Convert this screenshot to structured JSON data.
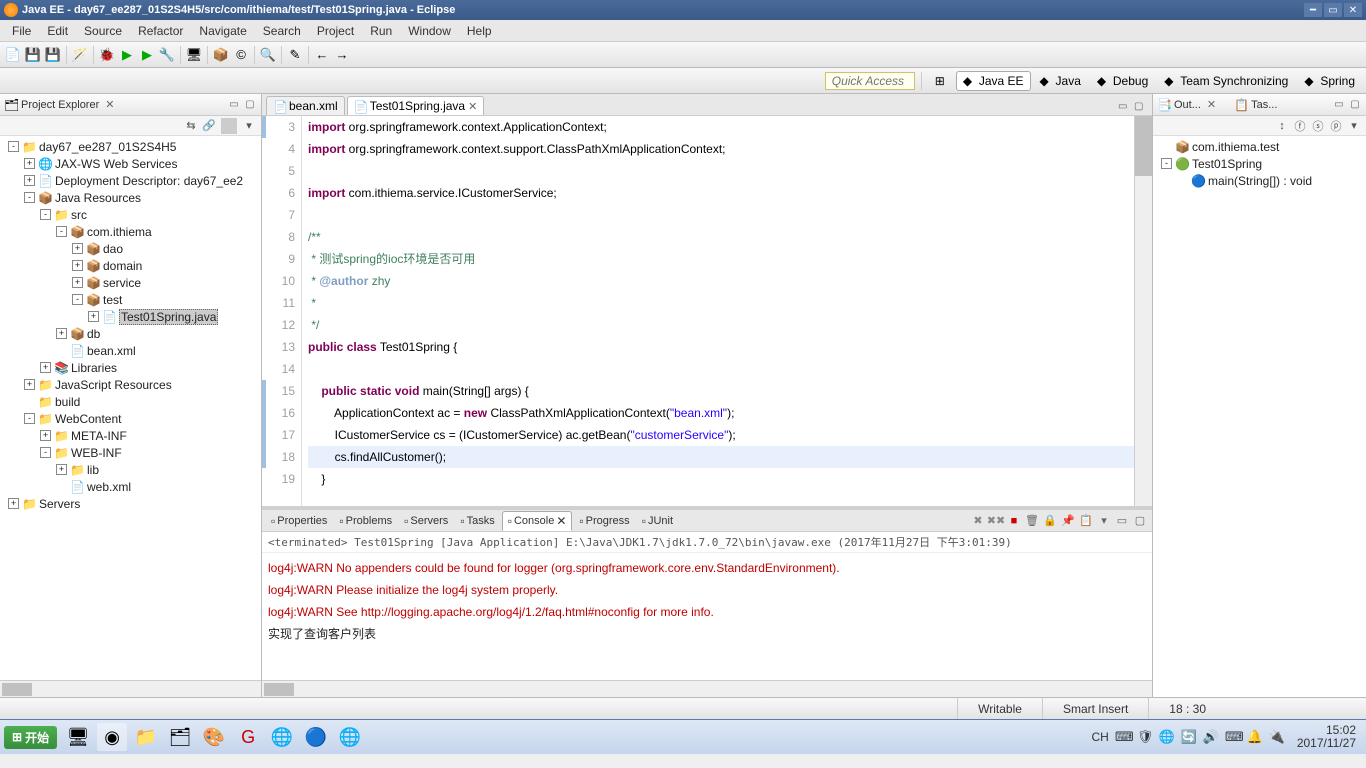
{
  "title": "Java EE - day67_ee287_01S2S4H5/src/com/ithiema/test/Test01Spring.java - Eclipse",
  "menu": [
    "File",
    "Edit",
    "Source",
    "Refactor",
    "Navigate",
    "Search",
    "Project",
    "Run",
    "Window",
    "Help"
  ],
  "quick_access": "Quick Access",
  "perspectives": [
    {
      "label": "Java EE",
      "active": true
    },
    {
      "label": "Java",
      "active": false
    },
    {
      "label": "Debug",
      "active": false
    },
    {
      "label": "Team Synchronizing",
      "active": false
    },
    {
      "label": "Spring",
      "active": false
    }
  ],
  "project_explorer": {
    "title": "Project Explorer",
    "tree": [
      {
        "depth": 0,
        "exp": "-",
        "ico": "📁",
        "label": "day67_ee287_01S2S4H5"
      },
      {
        "depth": 1,
        "exp": "+",
        "ico": "🌐",
        "label": "JAX-WS Web Services"
      },
      {
        "depth": 1,
        "exp": "+",
        "ico": "📄",
        "label": "Deployment Descriptor: day67_ee2"
      },
      {
        "depth": 1,
        "exp": "-",
        "ico": "📦",
        "label": "Java Resources"
      },
      {
        "depth": 2,
        "exp": "-",
        "ico": "📁",
        "label": "src"
      },
      {
        "depth": 3,
        "exp": "-",
        "ico": "📦",
        "label": "com.ithiema"
      },
      {
        "depth": 4,
        "exp": "+",
        "ico": "📦",
        "label": "dao"
      },
      {
        "depth": 4,
        "exp": "+",
        "ico": "📦",
        "label": "domain"
      },
      {
        "depth": 4,
        "exp": "+",
        "ico": "📦",
        "label": "service"
      },
      {
        "depth": 4,
        "exp": "-",
        "ico": "📦",
        "label": "test"
      },
      {
        "depth": 5,
        "exp": "+",
        "ico": "📄",
        "label": "Test01Spring.java",
        "selected": true
      },
      {
        "depth": 3,
        "exp": "+",
        "ico": "📦",
        "label": "db"
      },
      {
        "depth": 3,
        "exp": "",
        "ico": "📄",
        "label": "bean.xml"
      },
      {
        "depth": 2,
        "exp": "+",
        "ico": "📚",
        "label": "Libraries"
      },
      {
        "depth": 1,
        "exp": "+",
        "ico": "📁",
        "label": "JavaScript Resources"
      },
      {
        "depth": 1,
        "exp": "",
        "ico": "📁",
        "label": "build"
      },
      {
        "depth": 1,
        "exp": "-",
        "ico": "📁",
        "label": "WebContent"
      },
      {
        "depth": 2,
        "exp": "+",
        "ico": "📁",
        "label": "META-INF"
      },
      {
        "depth": 2,
        "exp": "-",
        "ico": "📁",
        "label": "WEB-INF"
      },
      {
        "depth": 3,
        "exp": "+",
        "ico": "📁",
        "label": "lib"
      },
      {
        "depth": 3,
        "exp": "",
        "ico": "📄",
        "label": "web.xml"
      },
      {
        "depth": 0,
        "exp": "+",
        "ico": "📁",
        "label": "Servers"
      }
    ]
  },
  "editor": {
    "tabs": [
      {
        "label": "bean.xml",
        "ico": "📄",
        "active": false
      },
      {
        "label": "Test01Spring.java",
        "ico": "📄",
        "active": true
      }
    ],
    "lines": [
      {
        "n": 3,
        "html": "<span class='kw'>import</span> org.springframework.context.ApplicationContext;"
      },
      {
        "n": 4,
        "html": "<span class='kw'>import</span> org.springframework.context.support.ClassPathXmlApplicationContext;"
      },
      {
        "n": 5,
        "html": ""
      },
      {
        "n": 6,
        "html": "<span class='kw'>import</span> com.ithiema.service.ICustomerService;"
      },
      {
        "n": 7,
        "html": ""
      },
      {
        "n": 8,
        "html": "<span class='cmt'>/**</span>"
      },
      {
        "n": 9,
        "html": "<span class='cmt'> * 测试spring的ioc环境是否可用</span>"
      },
      {
        "n": 10,
        "html": "<span class='cmt'> * </span><span class='cmtt'>@author</span><span class='cmt'> zhy</span>"
      },
      {
        "n": 11,
        "html": "<span class='cmt'> *</span>"
      },
      {
        "n": 12,
        "html": "<span class='cmt'> */</span>"
      },
      {
        "n": 13,
        "html": "<span class='kw'>public</span> <span class='kw'>class</span> Test01Spring {"
      },
      {
        "n": 14,
        "html": ""
      },
      {
        "n": 15,
        "html": "    <span class='kw'>public</span> <span class='kw'>static</span> <span class='kw'>void</span> main(String[] args) {"
      },
      {
        "n": 16,
        "html": "        ApplicationContext ac = <span class='kw'>new</span> ClassPathXmlApplicationContext(<span class='str'>\"bean.xml\"</span>);"
      },
      {
        "n": 17,
        "html": "        ICustomerService cs = (ICustomerService) ac.getBean(<span class='str'>\"customerService\"</span>);"
      },
      {
        "n": 18,
        "html": "        cs.findAllCustomer();",
        "current": true
      },
      {
        "n": 19,
        "html": "    }"
      }
    ]
  },
  "outline": {
    "title": "Out...",
    "tasks_title": "Tas...",
    "tree": [
      {
        "depth": 0,
        "exp": "",
        "ico": "📦",
        "label": "com.ithiema.test"
      },
      {
        "depth": 0,
        "exp": "-",
        "ico": "🟢",
        "label": "Test01Spring"
      },
      {
        "depth": 1,
        "exp": "",
        "ico": "🔵",
        "label": "main(String[]) : void"
      }
    ]
  },
  "bottom": {
    "tabs": [
      "Properties",
      "Problems",
      "Servers",
      "Tasks",
      "Console",
      "Progress",
      "JUnit"
    ],
    "active": "Console",
    "info": "<terminated> Test01Spring [Java Application] E:\\Java\\JDK1.7\\jdk1.7.0_72\\bin\\javaw.exe (2017年11月27日 下午3:01:39)",
    "lines": [
      {
        "cls": "warn",
        "text": "log4j:WARN No appenders could be found for logger (org.springframework.core.env.StandardEnvironment)."
      },
      {
        "cls": "warn",
        "text": "log4j:WARN Please initialize the log4j system properly."
      },
      {
        "cls": "warn",
        "text": "log4j:WARN See http://logging.apache.org/log4j/1.2/faq.html#noconfig for more info."
      },
      {
        "cls": "succ",
        "text": "实现了查询客户列表"
      }
    ]
  },
  "status": {
    "writable": "Writable",
    "insert_mode": "Smart Insert",
    "position": "18 : 30"
  },
  "taskbar": {
    "start": "开始",
    "ime": "CH",
    "time": "15:02",
    "date": "2017/11/27"
  }
}
